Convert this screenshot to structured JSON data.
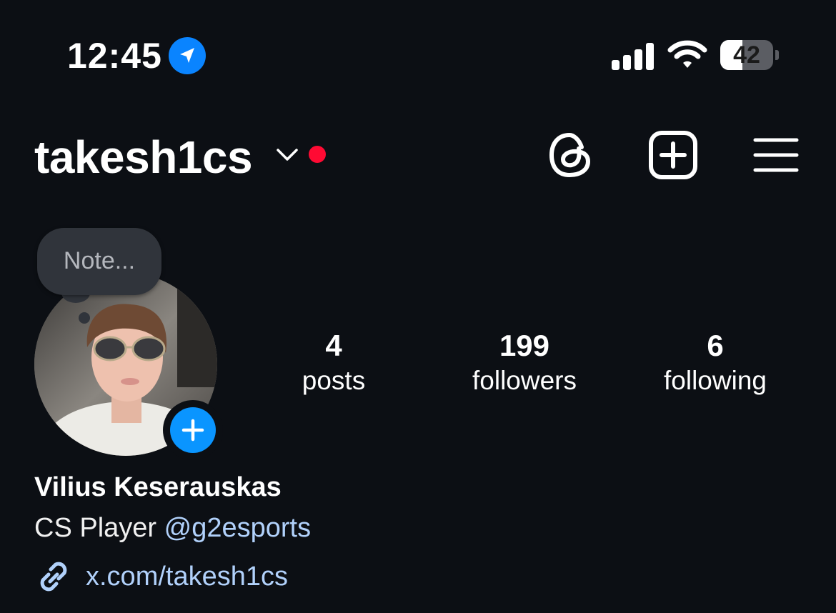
{
  "status_bar": {
    "time": "12:45",
    "battery": "42",
    "battery_level": 0.42,
    "location_active": true,
    "accent_color": "#0a84ff"
  },
  "header": {
    "username": "takesh1cs",
    "icons": [
      "chevron-down-icon",
      "threads-icon",
      "new-post-icon",
      "menu-icon"
    ],
    "notification_dot_color": "#ff0a33"
  },
  "profile": {
    "note_placeholder": "Note...",
    "avatar": "avatar",
    "stats": [
      {
        "value": "4",
        "label": "posts"
      },
      {
        "value": "199",
        "label": "followers"
      },
      {
        "value": "6",
        "label": "following"
      }
    ],
    "full_name": "Vilius Keserauskas",
    "bio_text": "CS Player ",
    "bio_mention": "@g2esports",
    "link": "x.com/takesh1cs",
    "link_color": "#b1d1fb"
  }
}
